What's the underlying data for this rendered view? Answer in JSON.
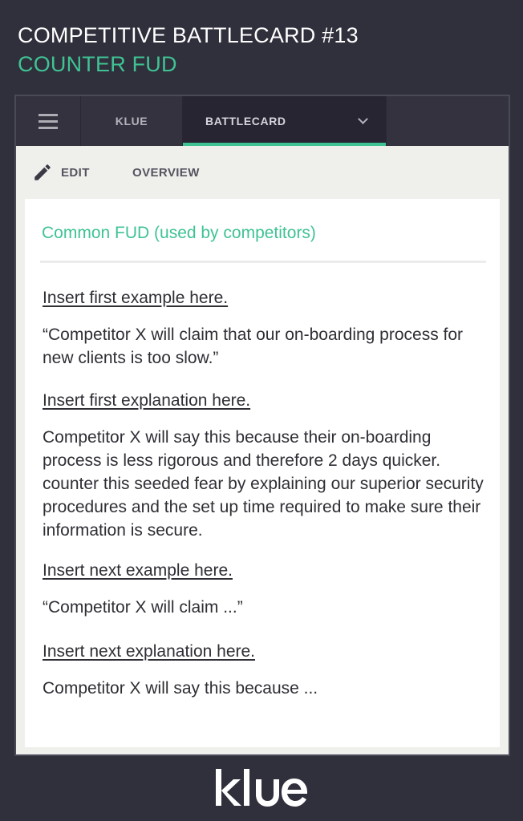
{
  "header": {
    "title": "COMPETITIVE BATTLECARD #13",
    "subtitle": "COUNTER FUD"
  },
  "nav": {
    "menu_icon": "hamburger-menu-icon",
    "tabs": [
      {
        "label": "KLUE",
        "active": false
      },
      {
        "label": "BATTLECARD",
        "active": true
      }
    ],
    "dropdown_icon": "chevron-down-icon",
    "accent_color": "#3fc393"
  },
  "toolbar": {
    "edit_icon": "pencil-icon",
    "edit_label": "EDIT",
    "overview_label": "OVERVIEW"
  },
  "card": {
    "heading": "Common FUD (used by competitors)",
    "entries": [
      {
        "text": "Insert first example here.",
        "link": true
      },
      {
        "text": "“Competitor X will claim that our on-boarding process for new clients is too slow.”",
        "link": false
      },
      {
        "text": "Insert first explanation here.",
        "link": true
      },
      {
        "text": "Competitor X will say this because their on-boarding process is less rigorous and therefore 2 days quicker. counter this seeded fear by explaining our superior security procedures and the set up time required to make sure their information is secure.",
        "link": false
      },
      {
        "text": "Insert next example here.",
        "link": true
      },
      {
        "text": "“Competitor X will claim ...”",
        "link": false
      },
      {
        "text": "Insert next explanation here.",
        "link": true
      },
      {
        "text": "Competitor X will say this because ...",
        "link": false
      }
    ]
  },
  "footer": {
    "logo_text": "klue"
  },
  "colors": {
    "background": "#302f3c",
    "accent": "#3fc393",
    "nav": "#33323e",
    "panel": "#efefec"
  }
}
